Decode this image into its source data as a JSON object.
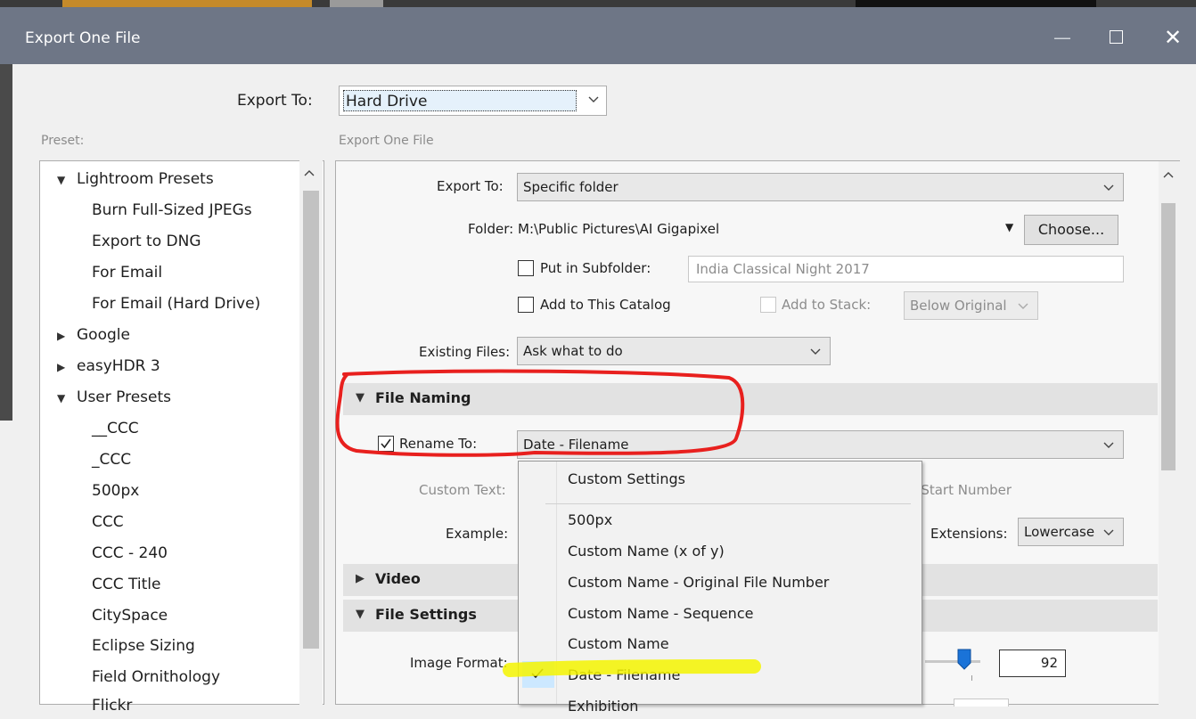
{
  "window": {
    "title": "Export One File"
  },
  "header": {
    "export_to_label": "Export To:",
    "export_to_value": "Hard Drive"
  },
  "preset": {
    "label": "Preset:",
    "items": [
      {
        "label": "Lightroom Presets",
        "expanded": true
      },
      {
        "label": "Burn Full-Sized JPEGs"
      },
      {
        "label": "Export to DNG"
      },
      {
        "label": "For Email"
      },
      {
        "label": "For Email (Hard Drive)"
      },
      {
        "label": "Google",
        "expanded": false
      },
      {
        "label": "easyHDR 3",
        "expanded": false
      },
      {
        "label": "User Presets",
        "expanded": true
      },
      {
        "label": "__CCC"
      },
      {
        "label": "_CCC"
      },
      {
        "label": "500px"
      },
      {
        "label": "CCC"
      },
      {
        "label": "CCC - 240"
      },
      {
        "label": "CCC Title"
      },
      {
        "label": "CitySpace"
      },
      {
        "label": "Eclipse Sizing"
      },
      {
        "label": "Field Ornithology"
      },
      {
        "label": "Flickr"
      }
    ]
  },
  "main": {
    "breadcrumb": "Export One File",
    "export_location": {
      "export_to_label": "Export To:",
      "export_to_value": "Specific folder",
      "folder_label": "Folder:",
      "folder_value": "M:\\Public Pictures\\AI Gigapixel",
      "choose_button": "Choose...",
      "subfolder_label": "Put in Subfolder:",
      "subfolder_value": "India Classical Night 2017",
      "add_catalog_label": "Add to This Catalog",
      "add_stack_label": "Add to Stack:",
      "stack_value": "Below Original",
      "existing_files_label": "Existing Files:",
      "existing_files_value": "Ask what to do"
    },
    "file_naming": {
      "title": "File Naming",
      "rename_label": "Rename To:",
      "rename_value": "Date - Filename",
      "custom_text_label": "Custom Text:",
      "start_number_label": "Start Number:",
      "example_label": "Example:",
      "extensions_label": "Extensions:",
      "extensions_value": "Lowercase"
    },
    "video": {
      "title": "Video"
    },
    "file_settings": {
      "title": "File Settings",
      "image_format_label": "Image Format:",
      "quality_value": "92",
      "quality_fraction": 0.92
    }
  },
  "dropdown": {
    "options": [
      "Custom Settings",
      "500px",
      "Custom Name (x of y)",
      "Custom Name - Original File Number",
      "Custom Name - Sequence",
      "Custom Name",
      "Date - Filename",
      "Exhibition"
    ],
    "selected": "Date - Filename"
  },
  "colors": {
    "titlebar": "#6e7686",
    "annotation_red": "#e8201e",
    "highlight_yellow": "#f4f400"
  }
}
